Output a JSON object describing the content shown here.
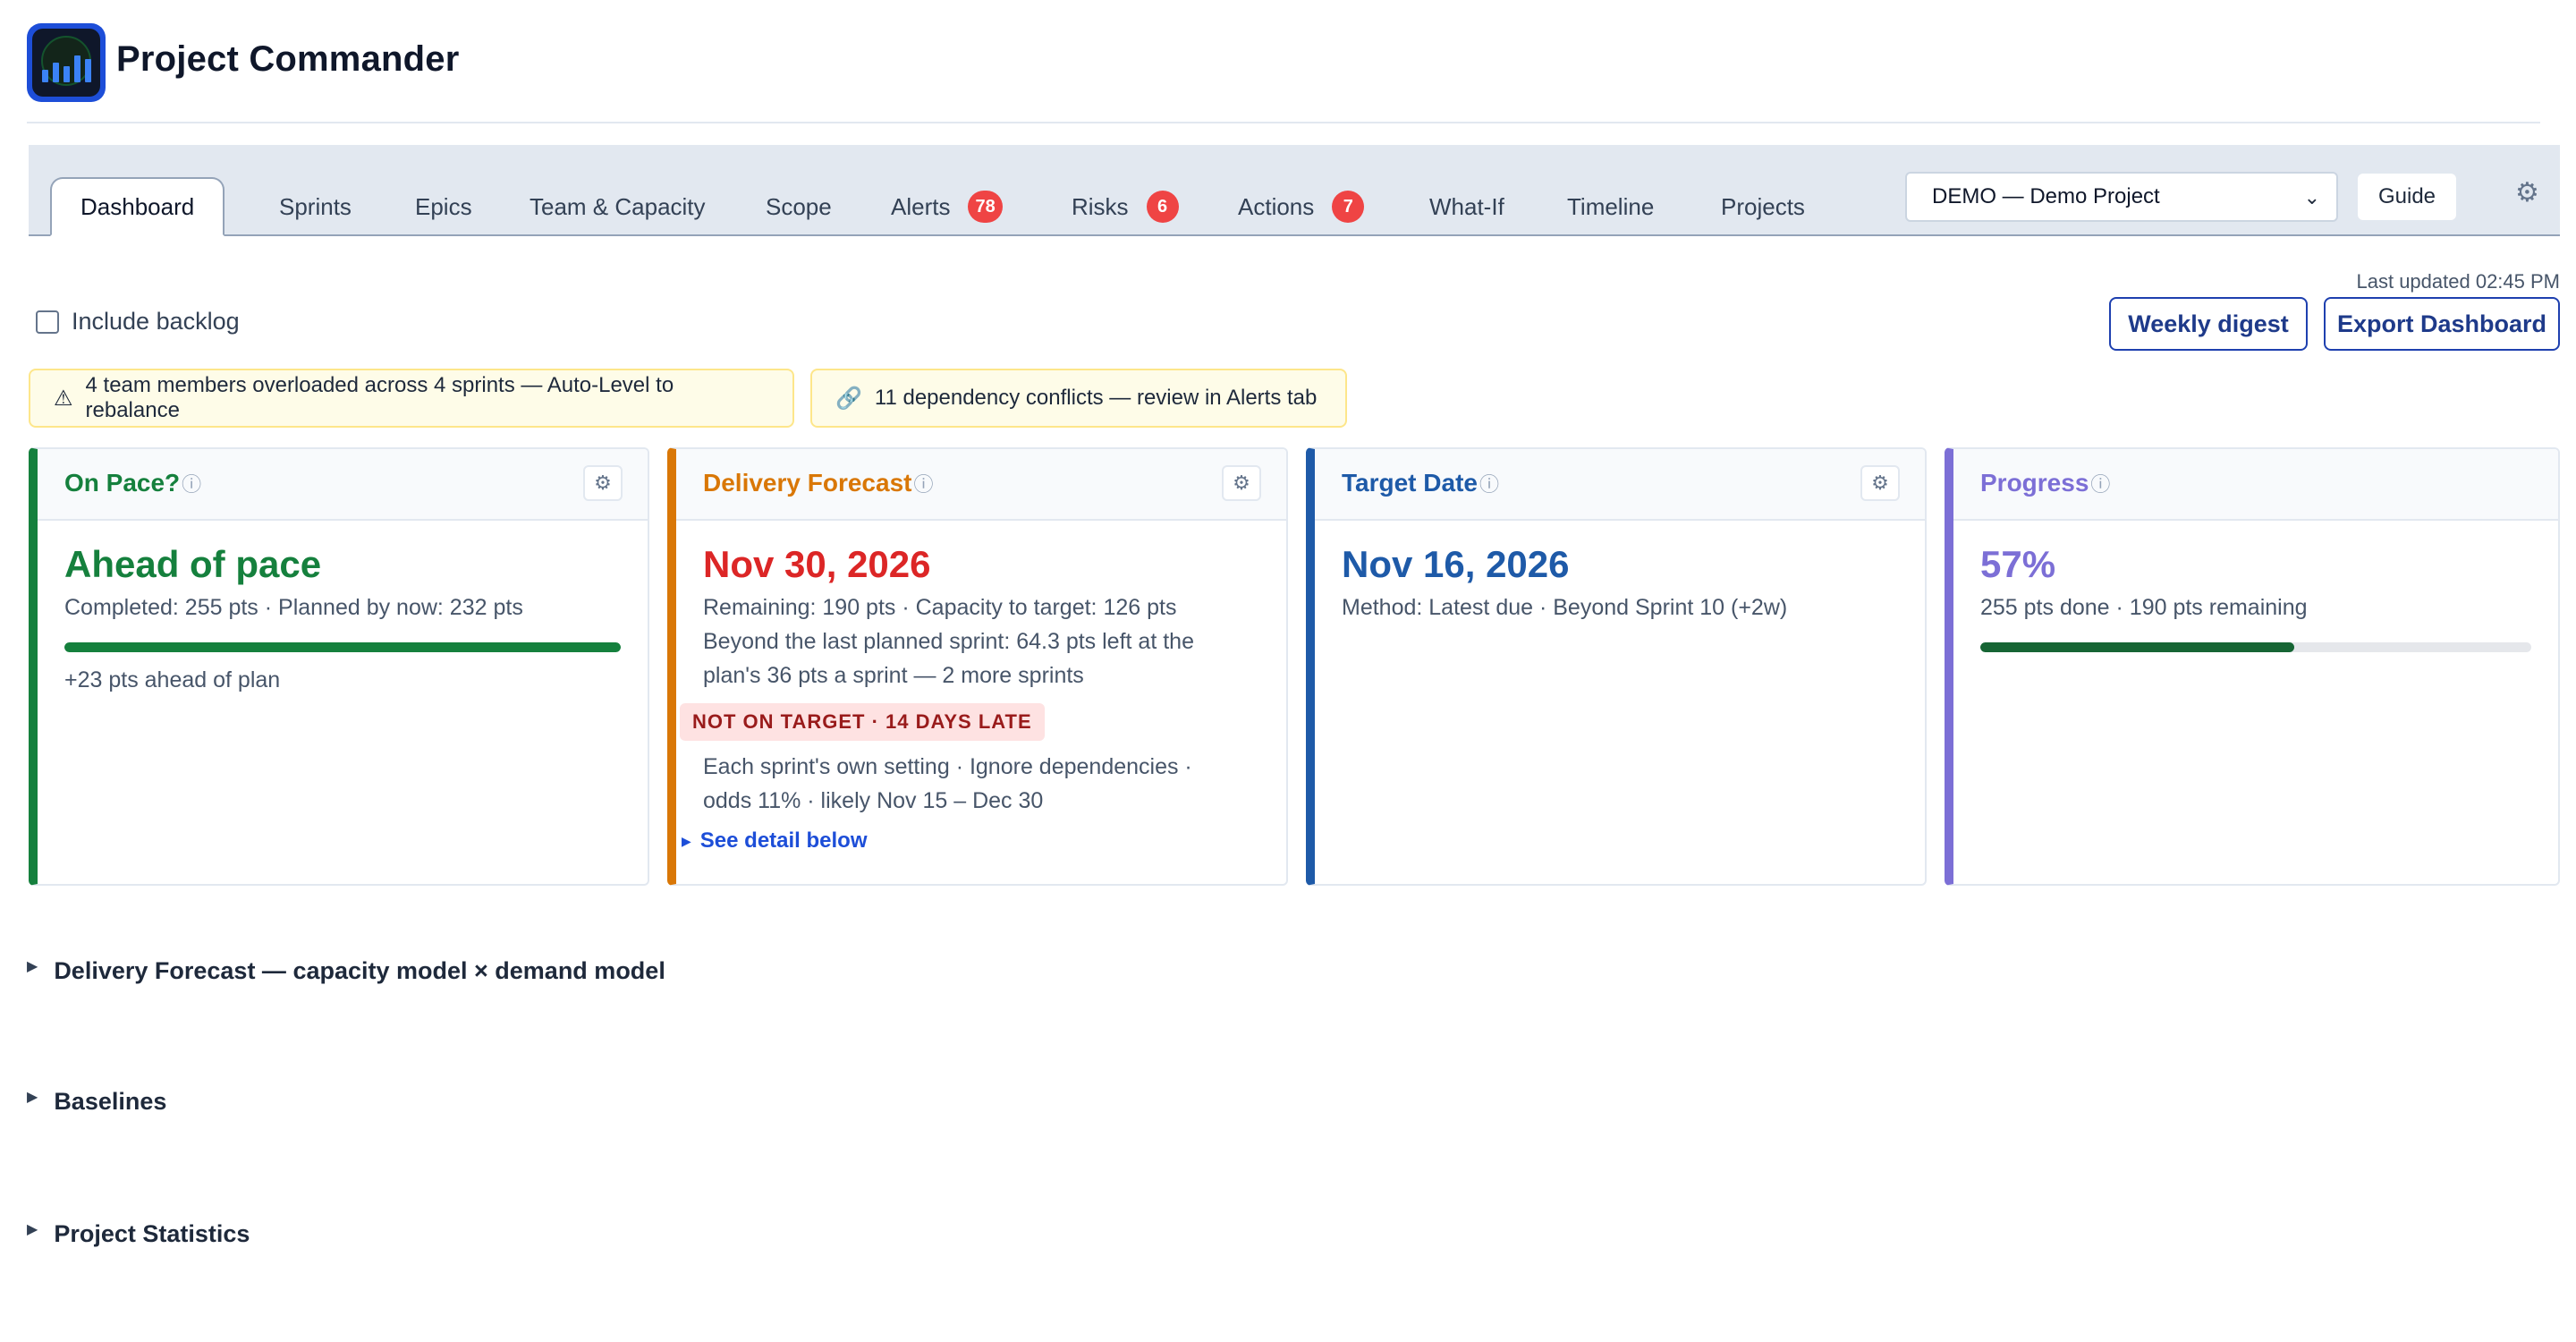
{
  "app": {
    "title": "Project Commander"
  },
  "tabs": [
    {
      "label": "Dashboard",
      "badge": null
    },
    {
      "label": "Sprints",
      "badge": null
    },
    {
      "label": "Epics",
      "badge": null
    },
    {
      "label": "Team & Capacity",
      "badge": null
    },
    {
      "label": "Scope",
      "badge": null
    },
    {
      "label": "Alerts",
      "badge": "78"
    },
    {
      "label": "Risks",
      "badge": "6"
    },
    {
      "label": "Actions",
      "badge": "7"
    },
    {
      "label": "What-If",
      "badge": null
    },
    {
      "label": "Timeline",
      "badge": null
    },
    {
      "label": "Projects",
      "badge": null
    }
  ],
  "toolbar": {
    "project": "DEMO — Demo Project",
    "guide": "Guide"
  },
  "last_updated": "Last updated 02:45 PM",
  "controls": {
    "include_backlog": "Include backlog",
    "weekly_digest": "Weekly digest",
    "export": "Export Dashboard"
  },
  "banners": [
    {
      "icon": "⚠",
      "text": "4 team members overloaded across 4 sprints — Auto-Level to rebalance"
    },
    {
      "icon": "🔗",
      "text": "11 dependency conflicts — review in Alerts tab"
    }
  ],
  "cards": {
    "pace": {
      "title": "On Pace?",
      "headline": "Ahead of pace",
      "sub": "Completed: 255 pts · Planned by now: 232 pts",
      "progress": 1.0,
      "note": "+23 pts ahead of plan",
      "color": "#15803d"
    },
    "forecast": {
      "title": "Delivery Forecast",
      "headline": "Nov 30, 2026",
      "sub": "Remaining: 190 pts · Capacity to target: 126 pts",
      "detail_1": "Beyond the last planned sprint: 64.3 pts left at the",
      "detail_2": "plan's 36 pts a sprint — 2 more sprints",
      "tag": "NOT ON TARGET · 14 DAYS LATE",
      "settings_1": "Each sprint's own setting · Ignore dependencies ·",
      "settings_2": "odds 11% · likely Nov 15 – Dec 30",
      "link": "See detail below",
      "color": "#d97706"
    },
    "target": {
      "title": "Target Date",
      "headline": "Nov 16, 2026",
      "sub": "Method: Latest due · Beyond Sprint 10 (+2w)",
      "color": "#1e5aa8"
    },
    "progress": {
      "title": "Progress",
      "headline": "57%",
      "sub": "255 pts done · 190 pts remaining",
      "progress": 0.57,
      "color": "#7c6fd6"
    }
  },
  "sections": [
    "Delivery Forecast — capacity model × demand model",
    "Baselines",
    "Project Statistics"
  ]
}
